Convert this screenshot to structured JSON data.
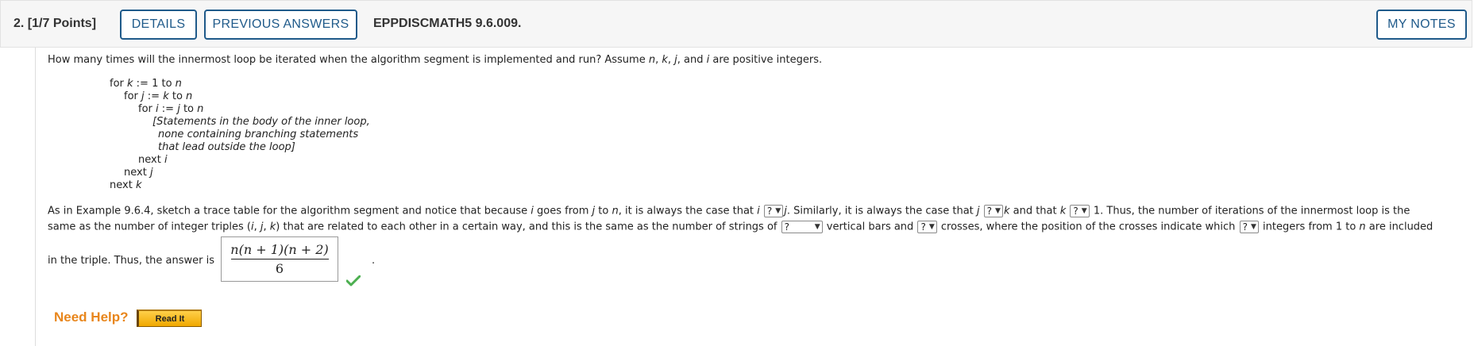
{
  "header": {
    "question_number": "2.",
    "points": "[1/7 Points]",
    "details_label": "DETAILS",
    "previous_answers_label": "PREVIOUS ANSWERS",
    "question_code": "EPPDISCMATH5 9.6.009.",
    "my_notes_label": "MY NOTES"
  },
  "prompt": {
    "intro_a": "How many times will the innermost loop be iterated when the algorithm segment is implemented and run? Assume ",
    "var_n": "n",
    "comma1": ", ",
    "var_k": "k",
    "comma2": ", ",
    "var_j": "j",
    "and": ", and ",
    "var_i": "i",
    "intro_b": " are positive integers."
  },
  "code": {
    "l1a": "for ",
    "l1v": "k",
    "l1b": " := 1 to ",
    "l1c": "n",
    "l2a": "for ",
    "l2v": "j",
    "l2b": " := ",
    "l2c": "k",
    "l2d": " to ",
    "l2e": "n",
    "l3a": "for ",
    "l3v": "i",
    "l3b": " := ",
    "l3c": "j",
    "l3d": " to ",
    "l3e": "n",
    "l4": "[Statements in the body of the inner loop,",
    "l5": "none containing branching statements",
    "l6": "that lead outside the loop]",
    "l7a": "next ",
    "l7v": "i",
    "l8a": "next ",
    "l8v": "j",
    "l9a": "next ",
    "l9v": "k"
  },
  "para": {
    "p1a": "As in Example 9.6.4, sketch a trace table for the algorithm segment and notice that because ",
    "p1b": "i",
    "p1c": " goes from ",
    "p1d": "j",
    "p1e": " to ",
    "p1f": "n",
    "p1g": ", it is always the case that ",
    "p1h": "i",
    "p1i": "j",
    "p1j": ". Similarly, it is always the case that ",
    "p1k": "j",
    "p1l": "k",
    "p1m": " and that ",
    "p1n": "k",
    "p1o": " 1. Thus, the number of iterations of the innermost loop is the",
    "p2a": "same as the number of integer triples (",
    "p2b": "i",
    "p2c": ", ",
    "p2d": "j",
    "p2e": ", ",
    "p2f": "k",
    "p2g": ") that are related to each other in a certain way, and this is the same as the number of strings of ",
    "p2h": " vertical bars and ",
    "p2i": " crosses, where the position of the crosses indicate which ",
    "p2j": " integers from 1 to ",
    "p2k": "n",
    "p2l": " are included",
    "p3a": "in the triple. Thus, the answer is",
    "p3b": "."
  },
  "selects": {
    "s1": "?",
    "s2": "?",
    "s3": "?",
    "s4": "?",
    "s5": "?",
    "s6": "?"
  },
  "answer": {
    "numerator": "n(n + 1)(n + 2)",
    "denominator": "6",
    "status_icon": "check-icon",
    "status_color": "#4caf50"
  },
  "help": {
    "need_help_label": "Need Help?",
    "read_it_label": "Read It",
    "accent_color": "#e8861c"
  }
}
